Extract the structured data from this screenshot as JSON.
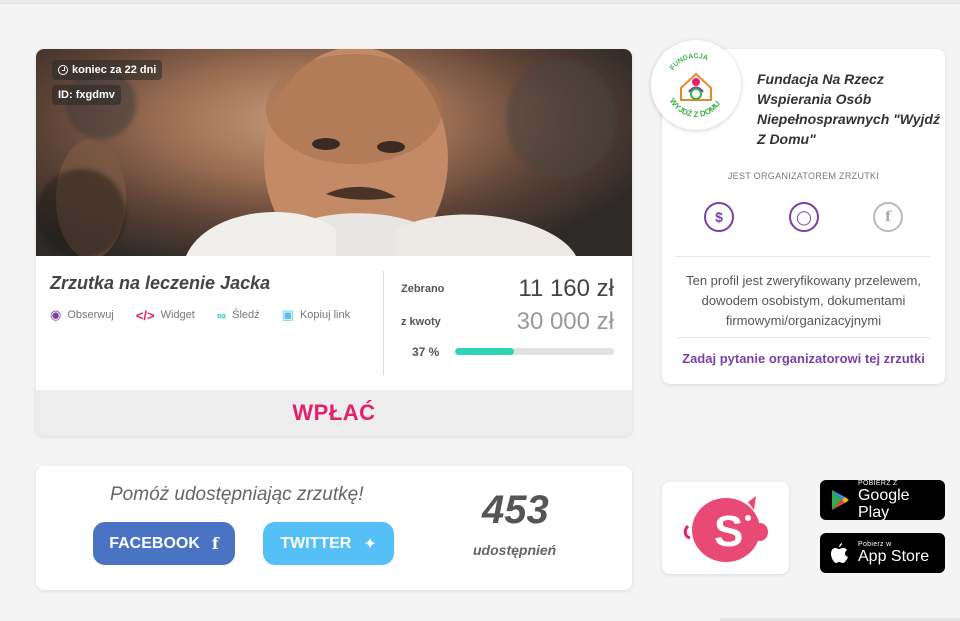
{
  "campaign": {
    "time_left": "koniec za 22 dni",
    "id": "ID: fxgdmv",
    "title": "Zrzutka na leczenie Jacka",
    "actions": [
      {
        "label": "Obserwuj",
        "icon": "eye-icon"
      },
      {
        "label": "Widget",
        "icon": "code-icon"
      },
      {
        "label": "Śledź",
        "icon": "link-icon"
      },
      {
        "label": "Kopiuj link",
        "icon": "clipboard-icon"
      }
    ],
    "raised_label": "Zebrano",
    "raised_value": "11 160 zł",
    "goal_label": "z kwoty",
    "goal_value": "30 000 zł",
    "progress_text": "37 %",
    "progress_fraction": 0.37,
    "donate_label": "WPŁAĆ"
  },
  "organizer": {
    "name": "Fundacja Na Rzecz Wspierania Osób Niepełnosprawnych \"Wyjdź Z Domu\"",
    "role": "JEST ORGANIZATOREM ZRZUTKI",
    "icons": [
      "dollar-icon",
      "user-icon",
      "facebook-icon"
    ],
    "verified_text": "Ten profil jest zweryfikowany przelewem, dowodem osobistym, dokumentami firmowymi/organizacyjnymi",
    "ask_link": "Zadaj pytanie organizatorowi tej zrzutki",
    "logo_text_top": "FUNDACJA",
    "logo_text_bottom": "WYJDŹ Z DOMU"
  },
  "share": {
    "heading": "Pomóż udostępniając zrzutkę!",
    "facebook_label": "FACEBOOK",
    "twitter_label": "TWITTER",
    "count": "453",
    "count_label": "udostępnień"
  },
  "apps": {
    "google_small": "POBIERZ Z",
    "google_big": "Google Play",
    "apple_small": "Pobierz w",
    "apple_big": "App Store"
  },
  "colors": {
    "accent_pink": "#e5206a",
    "accent_purple": "#7b3fa8",
    "progress": "#2fd3b5",
    "facebook": "#4a73c4",
    "twitter": "#55c0f5"
  }
}
